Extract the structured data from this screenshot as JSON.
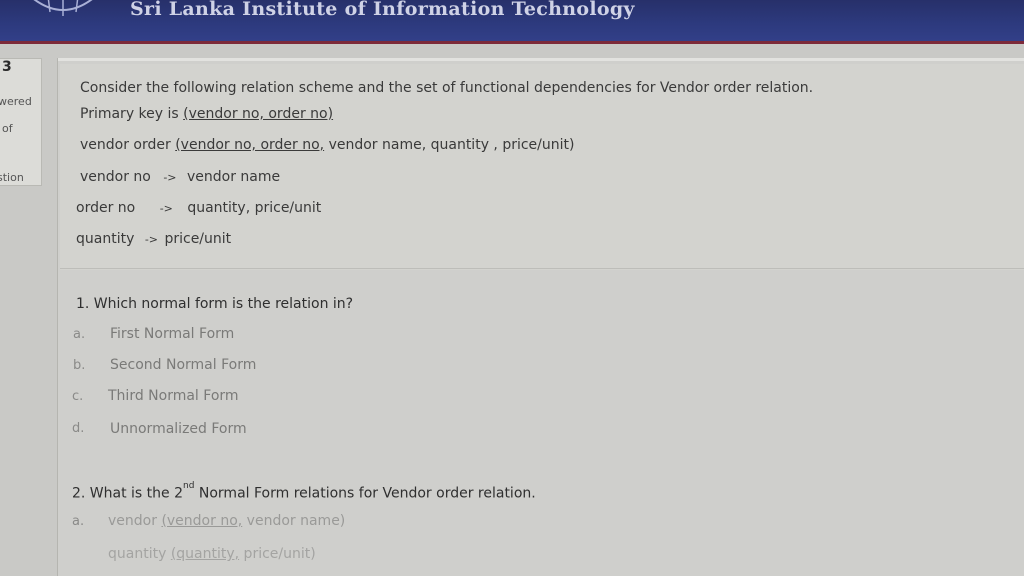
{
  "header": {
    "title": "Sri Lanka Institute of Information Technology"
  },
  "sidebar": {
    "number": "3",
    "text1": "wered",
    "text2": "of",
    "text3": "stion"
  },
  "scheme": {
    "intro": "Consider the following relation scheme and the set of functional dependencies for Vendor order relation.",
    "pk_prefix": "Primary key is ",
    "pk_value": "(vendor no, order no)",
    "relation_prefix": "vendor order ",
    "relation_keys": "(vendor no, order no,",
    "relation_rest": " vendor name, quantity , price/unit)",
    "fd1_left": "vendor no",
    "fd1_arrow": "->",
    "fd1_right": "vendor name",
    "fd2_left": "order no",
    "fd2_arrow": "->",
    "fd2_right": "quantity, price/unit",
    "fd3_left": "quantity",
    "fd3_arrow": "->",
    "fd3_right": "price/unit"
  },
  "question1": {
    "text": "1. Which normal form is the relation in?",
    "options": [
      {
        "letter": "a.",
        "text": "First Normal Form"
      },
      {
        "letter": "b.",
        "text": "Second Normal Form"
      },
      {
        "letter": "c.",
        "text": "Third Normal Form"
      },
      {
        "letter": "d.",
        "text": "Unnormalized Form"
      }
    ]
  },
  "question2": {
    "text_before": "2. What is the 2",
    "superscript": "nd",
    "text_after": " Normal Form relations for Vendor order relation.",
    "answer_letter": "a.",
    "answer_line1_prefix": "vendor ",
    "answer_line1_key": "(vendor no,",
    "answer_line1_rest": " vendor name)",
    "answer_line2_prefix": "quantity ",
    "answer_line2_key": "(quantity,",
    "answer_line2_rest": " price/unit)"
  },
  "colors": {
    "header_bg": "#2d3a7e",
    "header_strip": "#7d2a3a",
    "page_bg": "#cfcfcc"
  }
}
